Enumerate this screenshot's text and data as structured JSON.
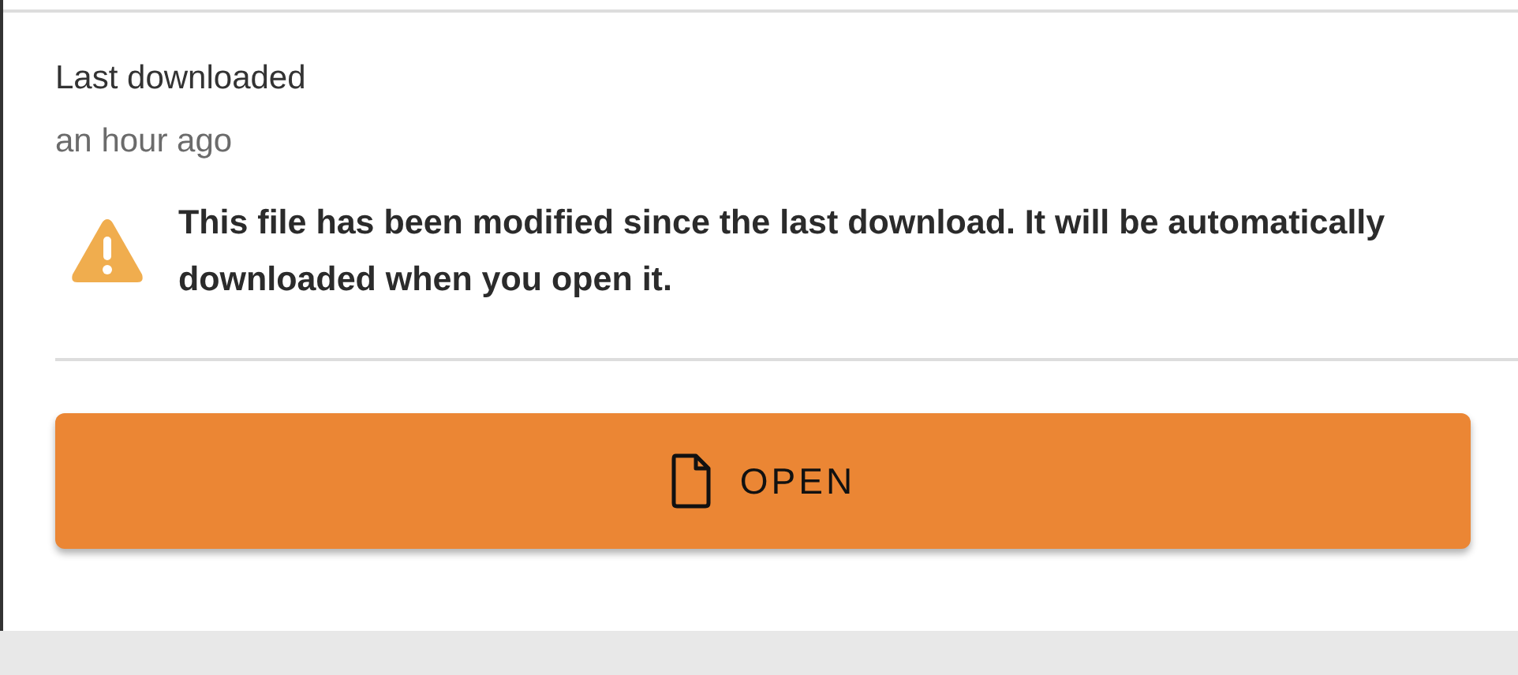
{
  "last_downloaded": {
    "label": "Last downloaded",
    "value": "an hour ago"
  },
  "warning": {
    "text": "This file has been modified since the last download. It will be automatically downloaded when you open it."
  },
  "open_button": {
    "label": "OPEN"
  }
}
